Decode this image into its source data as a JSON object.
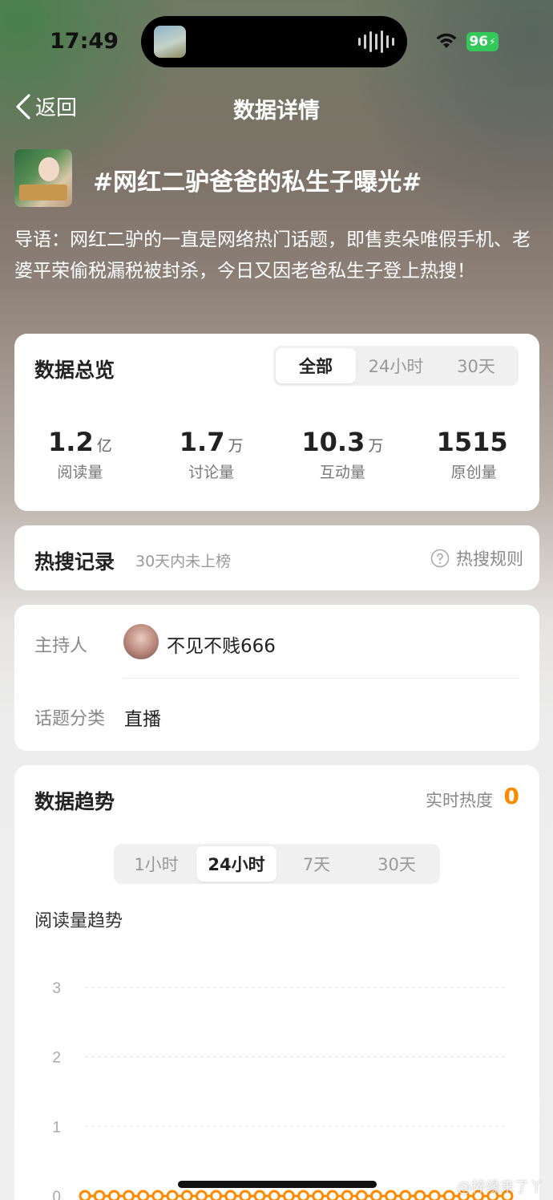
{
  "status": {
    "time": "17:49",
    "battery": "96"
  },
  "nav": {
    "back_label": "返回",
    "title": "数据详情"
  },
  "topic": {
    "title": "#网红二驴爸爸的私生子曝光#",
    "description": "导语：网红二驴的一直是网络热门话题，即售卖朵唯假手机、老婆平荣偷税漏税被封杀，今日又因老爸私生子登上热搜！"
  },
  "overview": {
    "title": "数据总览",
    "tabs": [
      "全部",
      "24小时",
      "30天"
    ],
    "active_tab": "全部",
    "stats": [
      {
        "value": "1.2",
        "unit": "亿",
        "label": "阅读量"
      },
      {
        "value": "1.7",
        "unit": "万",
        "label": "讨论量"
      },
      {
        "value": "10.3",
        "unit": "万",
        "label": "互动量"
      },
      {
        "value": "1515",
        "unit": "",
        "label": "原创量"
      }
    ]
  },
  "hot_search": {
    "title": "热搜记录",
    "note": "30天内未上榜",
    "rules_label": "热搜规则"
  },
  "info": {
    "host_label": "主持人",
    "host_name": "不见不贱666",
    "category_label": "话题分类",
    "category_value": "直播"
  },
  "trend": {
    "title": "数据趋势",
    "heat_label": "实时热度",
    "heat_value": "0",
    "tabs": [
      "1小时",
      "24小时",
      "7天",
      "30天"
    ],
    "active_tab": "24小时",
    "chart_title": "阅读量趋势"
  },
  "chart_data": {
    "type": "line",
    "title": "阅读量趋势",
    "y_ticks": [
      "3",
      "2",
      "1",
      "0"
    ],
    "ylim": [
      0,
      3
    ],
    "grid": true,
    "series": [
      {
        "values": [
          0,
          0,
          0,
          0,
          0,
          0,
          0,
          0,
          0,
          0,
          0,
          0,
          0,
          0,
          0,
          0,
          0,
          0,
          0,
          0,
          0,
          0,
          0,
          0,
          0,
          0,
          0,
          0,
          0,
          0
        ]
      }
    ],
    "color": "#ff8a00"
  },
  "watermark": "@梓缘来了丫",
  "colors": {
    "accent": "#ff8a00",
    "battery": "#34c759"
  }
}
